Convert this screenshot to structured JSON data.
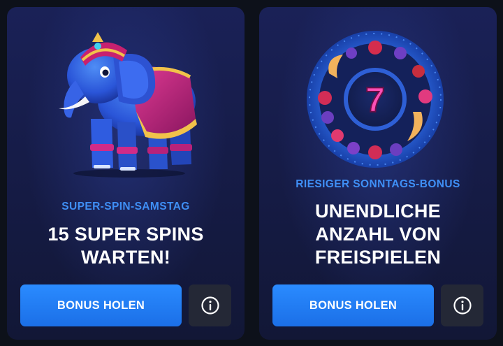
{
  "promos": [
    {
      "subtitle": "SUPER-SPIN-SAMSTAG",
      "headline": [
        "15 SUPER SPINS",
        "WARTEN!"
      ],
      "button_label": "BONUS HOLEN",
      "info_icon": "info-circle-icon",
      "art": "blue-elephant-icon"
    },
    {
      "subtitle": "RIESIGER SONNTAGS-BONUS",
      "headline": [
        "UNENDLICHE",
        "ANZAHL VON",
        "FREISPIELEN"
      ],
      "button_label": "BONUS HOLEN",
      "info_icon": "info-circle-icon",
      "art": "fruit-wheel-seven-icon",
      "art_text": "7"
    }
  ],
  "colors": {
    "accent": "#3f8ff5",
    "button": "#1f78f0",
    "card_bg": "#161c48",
    "page_bg": "#0d111a",
    "info_bg": "#242836"
  }
}
